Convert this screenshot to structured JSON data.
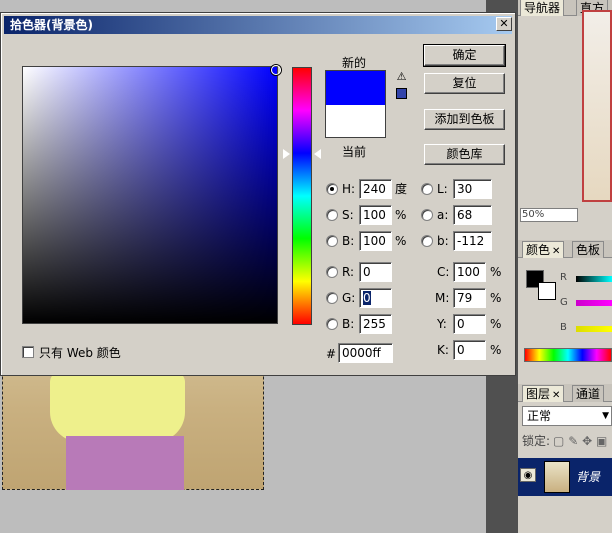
{
  "dialog": {
    "title": "拾色器(背景色)",
    "close_glyph": "✕"
  },
  "buttons": {
    "ok": "确定",
    "reset": "复位",
    "add_to_swatches": "添加到色板",
    "color_libraries": "颜色库"
  },
  "swatches": {
    "new_label": "新的",
    "current_label": "当前",
    "new_color": "#0000ff",
    "current_color": "#ffffff",
    "warning_glyph": "⚠"
  },
  "fields": {
    "H": {
      "label": "H:",
      "value": "240",
      "unit": "度"
    },
    "S": {
      "label": "S:",
      "value": "100",
      "unit": "%"
    },
    "B": {
      "label": "B:",
      "value": "100",
      "unit": "%"
    },
    "R": {
      "label": "R:",
      "value": "0"
    },
    "G": {
      "label": "G:",
      "value": "0"
    },
    "B2": {
      "label": "B:",
      "value": "255"
    },
    "L": {
      "label": "L:",
      "value": "30"
    },
    "a": {
      "label": "a:",
      "value": "68"
    },
    "b": {
      "label": "b:",
      "value": "-112"
    },
    "C": {
      "label": "C:",
      "value": "100",
      "unit": "%"
    },
    "M": {
      "label": "M:",
      "value": "79",
      "unit": "%"
    },
    "Y": {
      "label": "Y:",
      "value": "0",
      "unit": "%"
    },
    "K": {
      "label": "K:",
      "value": "0",
      "unit": "%"
    },
    "hex": {
      "label": "#",
      "value": "0000ff"
    }
  },
  "selected_mode": "H",
  "web_colors_only": {
    "label": "只有 Web 颜色",
    "checked": false
  },
  "panels": {
    "navigator": {
      "tabs": [
        "导航器",
        "直方"
      ],
      "zoom": "50%"
    },
    "color": {
      "tabs": [
        "颜色",
        "色板"
      ],
      "sliders": [
        "R",
        "G",
        "B"
      ],
      "foreground": "#000000",
      "background": "#ffffff"
    },
    "layers": {
      "tabs": [
        "图层",
        "通道"
      ],
      "blend_mode": "正常",
      "lock_label": "锁定:",
      "layer_name": "背景"
    }
  }
}
